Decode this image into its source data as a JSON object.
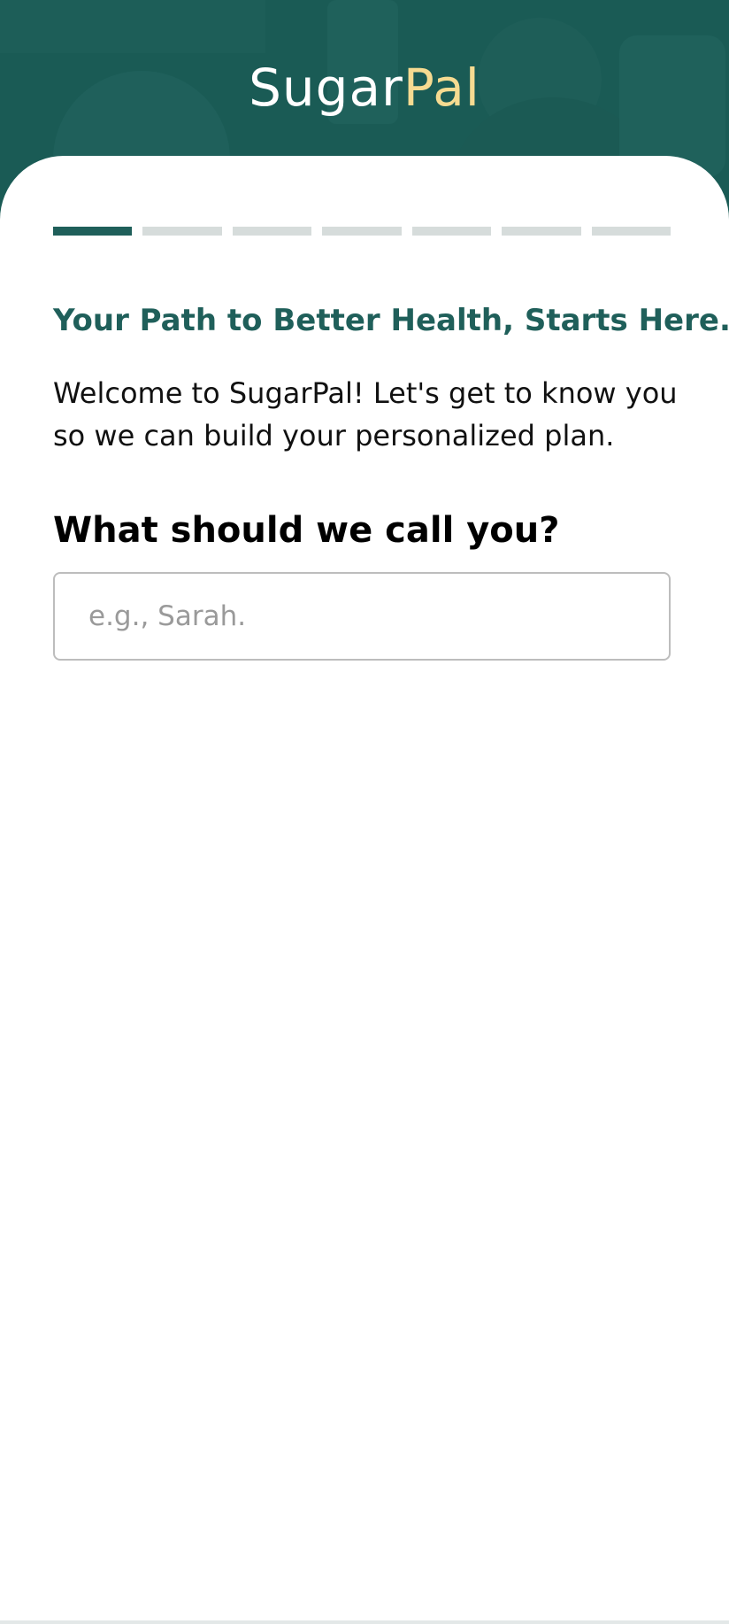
{
  "brand": {
    "name_part1": "Sugar",
    "name_part2": "Pal",
    "colors": {
      "primary_teal": "#1f5f5a",
      "accent_gold": "#f6db91",
      "progress_inactive": "#d6dcdb"
    }
  },
  "progress": {
    "current_step": 1,
    "total_steps": 7
  },
  "content": {
    "headline": "Your Path to Better Health, Starts Here.",
    "intro": "Welcome to SugarPal! Let's get to know you so we can build your personalized plan.",
    "question": "What should we call you?"
  },
  "name_field": {
    "value": "",
    "placeholder": "e.g., Sarah."
  }
}
